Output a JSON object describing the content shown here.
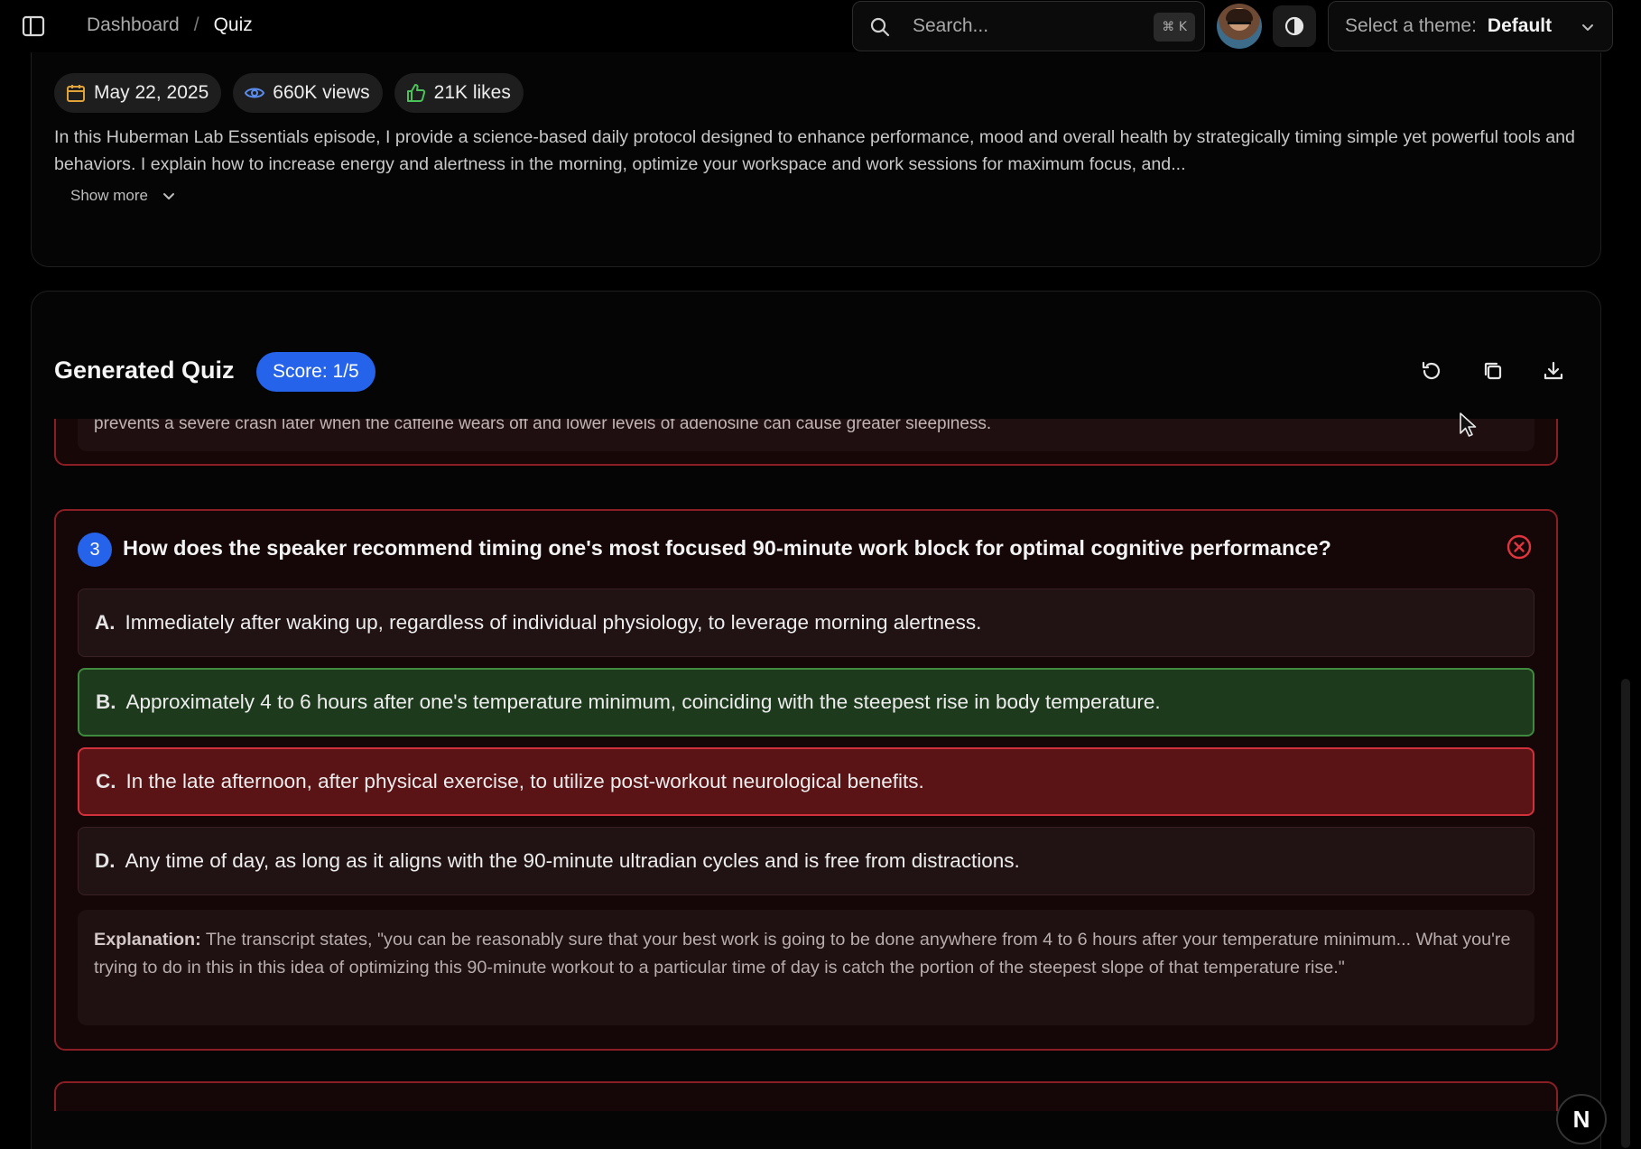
{
  "header": {
    "breadcrumb": {
      "parent": "Dashboard",
      "separator": "/",
      "current": "Quiz"
    },
    "search": {
      "placeholder": "Search...",
      "shortcut": "⌘ K"
    },
    "theme_select": {
      "label": "Select a theme:",
      "value": "Default"
    }
  },
  "video": {
    "date": "May 22, 2025",
    "views": "660K views",
    "likes": "21K likes",
    "description": "In this Huberman Lab Essentials episode, I provide a science-based daily protocol designed to enhance performance, mood and overall health by strategically timing simple yet powerful tools and behaviors. I explain how to increase energy and alertness in the morning, optimize your workspace and work sessions for maximum focus, and...",
    "show_more": "Show more"
  },
  "quiz": {
    "title": "Generated Quiz",
    "score": "Score: 1/5",
    "prev_explanation_tail": "prevents a severe crash later when the caffeine wears off and lower levels of adenosine can cause greater sleepiness.",
    "question": {
      "number": "3",
      "text": "How does the speaker recommend timing one's most focused 90-minute work block for optimal cognitive performance?",
      "options": [
        {
          "letter": "A.",
          "text": "Immediately after waking up, regardless of individual physiology, to leverage morning alertness.",
          "state": "neutral"
        },
        {
          "letter": "B.",
          "text": "Approximately 4 to 6 hours after one's temperature minimum, coinciding with the steepest rise in body temperature.",
          "state": "correct"
        },
        {
          "letter": "C.",
          "text": "In the late afternoon, after physical exercise, to utilize post-workout neurological benefits.",
          "state": "wrong"
        },
        {
          "letter": "D.",
          "text": "Any time of day, as long as it aligns with the 90-minute ultradian cycles and is free from distractions.",
          "state": "neutral"
        }
      ],
      "explanation_label": "Explanation:",
      "explanation_text": "The transcript states, \"you can be reasonably sure that your best work is going to be done anywhere from 4 to 6 hours after your temperature minimum... What you're trying to do in this in this idea of optimizing this 90-minute workout to a particular time of day is catch the portion of the steepest slope of that temperature rise.\""
    }
  },
  "floating_badge": "N",
  "colors": {
    "accent_blue": "#2563eb",
    "correct_green": "#3f8a3f",
    "wrong_red": "#d2313b",
    "card_border_red": "#8b1e24"
  }
}
